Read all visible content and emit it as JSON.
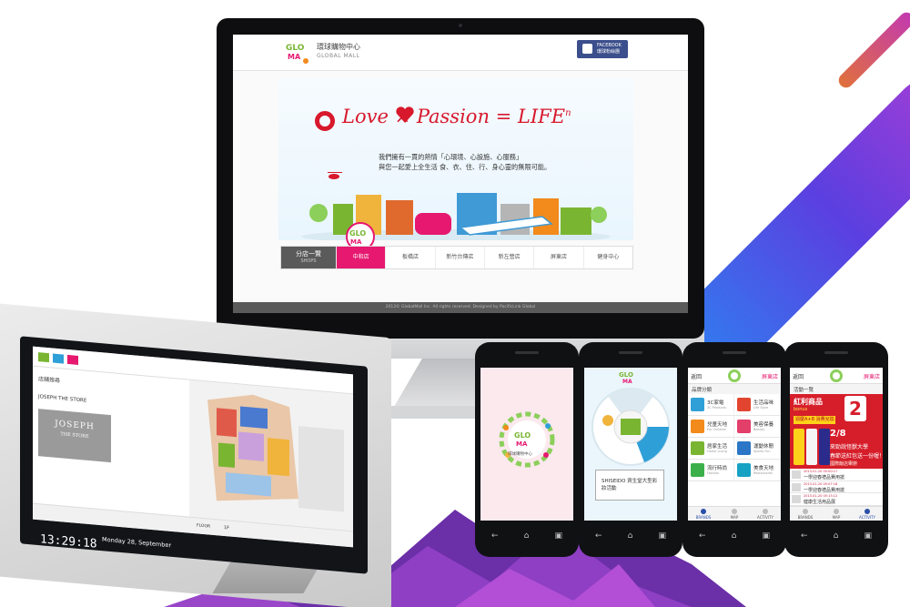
{
  "colors": {
    "accent_pink": "#e6186f",
    "slogan_red": "#d8182c",
    "facebook_blue": "#3b4f8c",
    "nav_gray": "#5a5a5a"
  },
  "website": {
    "logo_zh": "環球購物中心",
    "logo_en": "GLOBAL MALL",
    "facebook": {
      "line1": "FACEBOOK",
      "line2": "環球粉絲團"
    },
    "hero": {
      "slogan": "Love    × Passion = LIFE",
      "slogan_suffix": "n",
      "line1": "我們擁有一貫的熱情「心環境、心設施、心服務」",
      "line2": "與您一起愛上全生活 食、衣、住、行、身心靈的無限可能。"
    },
    "nav": {
      "shops_zh": "分店一覽",
      "shops_en": "SHOPS",
      "tabs": [
        "中和店",
        "板橋店",
        "新竹台傳店",
        "新左營店",
        "屏東店",
        "健身中心"
      ]
    },
    "footer": "2013© GlobalMall Inc. All rights reserved. Designed by PacificLink Global"
  },
  "kiosk": {
    "title": "店舖搜尋",
    "store_name": "JOSEPH THE STORE",
    "logo_line1": "JOSEPH",
    "logo_line2": "THE STORE",
    "floor_label": "FLOOR",
    "floor_value": "1F",
    "clock": "13:29:18",
    "date": "Monday 28, September"
  },
  "phone1": {
    "splash_title": "環球購物中心"
  },
  "phone2": {
    "popup_text": "SHISEIDO 資生堂大型彩妝活動"
  },
  "phone3": {
    "back": "返回",
    "store": "屏東店",
    "subtitle": "品牌分類",
    "categories": [
      {
        "zh": "3C家電",
        "en": "3C Products",
        "color": "#2f9fd8"
      },
      {
        "zh": "生活品味",
        "en": "Life Style",
        "color": "#e2452f"
      },
      {
        "zh": "兒童天地",
        "en": "For Children",
        "color": "#f28a1c"
      },
      {
        "zh": "美容保養",
        "en": "Beauty",
        "color": "#e23f6b"
      },
      {
        "zh": "居家生活",
        "en": "Home Living",
        "color": "#7ab532"
      },
      {
        "zh": "運動休閒",
        "en": "Sports Fun",
        "color": "#2b76c6"
      },
      {
        "zh": "流行時尚",
        "en": "Fashion",
        "color": "#3bb04a"
      },
      {
        "zh": "美食天地",
        "en": "Restaurants",
        "color": "#17a2c4"
      }
    ],
    "tabs": [
      "BRANDS",
      "MAP",
      "ACTIVITY"
    ]
  },
  "phone4": {
    "back": "返回",
    "store": "屏東店",
    "subtitle": "活動一覽",
    "banner": {
      "headline": "紅利商品",
      "sub": "bonus",
      "big_number": "2",
      "yellow": "週慶A+B 消費兌換",
      "t1": "2/8",
      "t2": "來勁說怪獸大學",
      "t3": "春節送紅包送一份喔！",
      "t4": "國際飯店舉辦"
    },
    "events": [
      {
        "date": "2013-01-20 05:00:17",
        "title": "一學迎春禮品費用搶"
      },
      {
        "date": "2013-01-20 05:07:18",
        "title": "一學迎春禮品費用搶"
      },
      {
        "date": "2013-01-20 05:13:12",
        "title": "健康生活用品展"
      }
    ],
    "tabs": [
      "BRANDS",
      "MAP",
      "ACTIVITY"
    ]
  }
}
